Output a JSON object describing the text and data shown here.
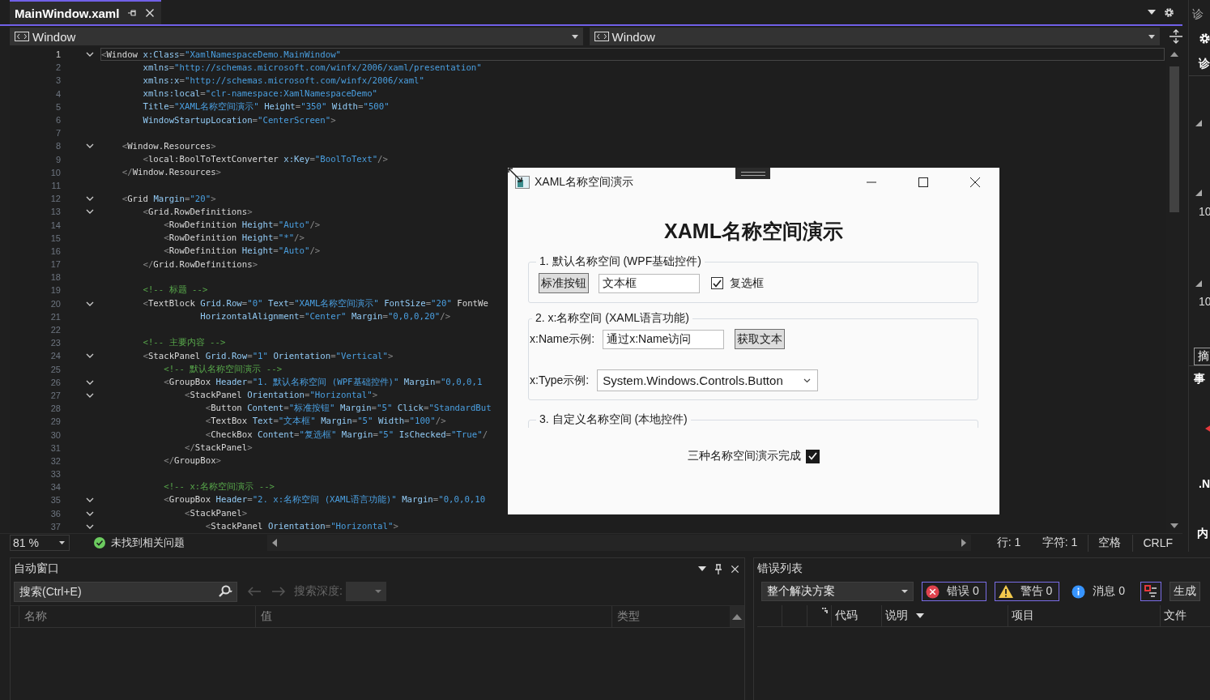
{
  "editor_tab": {
    "title": "MainWindow.xaml",
    "selected": true
  },
  "nav_bar": {
    "left_scope": "Window",
    "right_scope": "Window"
  },
  "code_lines": [
    {
      "number": "1",
      "fold": true,
      "current": true,
      "text": "<Window x:Class=\"XamlNamespaceDemo.MainWindow\""
    },
    {
      "number": "2",
      "fold": false,
      "current": false,
      "text": "        xmlns=\"http://schemas.microsoft.com/winfx/2006/xaml/presentation\""
    },
    {
      "number": "3",
      "fold": false,
      "current": false,
      "text": "        xmlns:x=\"http://schemas.microsoft.com/winfx/2006/xaml\""
    },
    {
      "number": "4",
      "fold": false,
      "current": false,
      "text": "        xmlns:local=\"clr-namespace:XamlNamespaceDemo\""
    },
    {
      "number": "5",
      "fold": false,
      "current": false,
      "text": "        Title=\"XAML名称空间演示\" Height=\"350\" Width=\"500\""
    },
    {
      "number": "6",
      "fold": false,
      "current": false,
      "text": "        WindowStartupLocation=\"CenterScreen\">"
    },
    {
      "number": "7",
      "fold": false,
      "current": false
    },
    {
      "number": "8",
      "fold": true,
      "current": false,
      "text": "    <Window.Resources>"
    },
    {
      "number": "9",
      "fold": false,
      "current": false,
      "text": "        <local:BoolToTextConverter x:Key=\"BoolToText\"/>"
    },
    {
      "number": "10",
      "fold": false,
      "current": false,
      "text": "    </Window.Resources>"
    },
    {
      "number": "11",
      "fold": false,
      "current": false
    },
    {
      "number": "12",
      "fold": true,
      "current": false,
      "text": "    <Grid Margin=\"20\">"
    },
    {
      "number": "13",
      "fold": true,
      "current": false,
      "text": "        <Grid.RowDefinitions>"
    },
    {
      "number": "14",
      "fold": false,
      "current": false,
      "text": "            <RowDefinition Height=\"Auto\"/>"
    },
    {
      "number": "15",
      "fold": false,
      "current": false,
      "text": "            <RowDefinition Height=\"*\"/>"
    },
    {
      "number": "16",
      "fold": false,
      "current": false,
      "text": "            <RowDefinition Height=\"Auto\"/>"
    },
    {
      "number": "17",
      "fold": false,
      "current": false,
      "text": "        </Grid.RowDefinitions>"
    },
    {
      "number": "18",
      "fold": false,
      "current": false
    },
    {
      "number": "19",
      "fold": false,
      "current": false,
      "text": "        <!-- 标题 -->"
    },
    {
      "number": "20",
      "fold": true,
      "current": false,
      "text": "        <TextBlock Grid.Row=\"0\" Text=\"XAML名称空间演示\" FontSize=\"20\" FontWe"
    },
    {
      "number": "21",
      "fold": false,
      "current": false,
      "text": "                   HorizontalAlignment=\"Center\" Margin=\"0,0,0,20\"/>"
    },
    {
      "number": "22",
      "fold": false,
      "current": false
    },
    {
      "number": "23",
      "fold": false,
      "current": false,
      "text": "        <!-- 主要内容 -->"
    },
    {
      "number": "24",
      "fold": true,
      "current": false,
      "text": "        <StackPanel Grid.Row=\"1\" Orientation=\"Vertical\">"
    },
    {
      "number": "25",
      "fold": false,
      "current": false,
      "text": "            <!-- 默认名称空间演示 -->"
    },
    {
      "number": "26",
      "fold": true,
      "current": false,
      "text": "            <GroupBox Header=\"1. 默认名称空间 (WPF基础控件)\" Margin=\"0,0,0,1"
    },
    {
      "number": "27",
      "fold": true,
      "current": false,
      "text": "                <StackPanel Orientation=\"Horizontal\">"
    },
    {
      "number": "28",
      "fold": false,
      "current": false,
      "text": "                    <Button Content=\"标准按钮\" Margin=\"5\" Click=\"StandardBut"
    },
    {
      "number": "29",
      "fold": false,
      "current": false,
      "text": "                    <TextBox Text=\"文本框\" Margin=\"5\" Width=\"100\"/>"
    },
    {
      "number": "30",
      "fold": false,
      "current": false,
      "text": "                    <CheckBox Content=\"复选框\" Margin=\"5\" IsChecked=\"True\"/"
    },
    {
      "number": "31",
      "fold": false,
      "current": false,
      "text": "                </StackPanel>"
    },
    {
      "number": "32",
      "fold": false,
      "current": false,
      "text": "            </GroupBox>"
    },
    {
      "number": "33",
      "fold": false,
      "current": false
    },
    {
      "number": "34",
      "fold": false,
      "current": false,
      "text": "            <!-- x:名称空间演示 -->"
    },
    {
      "number": "35",
      "fold": true,
      "current": false,
      "text": "            <GroupBox Header=\"2. x:名称空间 (XAML语言功能)\" Margin=\"0,0,0,10"
    },
    {
      "number": "36",
      "fold": true,
      "current": false,
      "text": "                <StackPanel>"
    },
    {
      "number": "37",
      "fold": true,
      "current": false,
      "text": "                    <StackPanel Orientation=\"Horizontal\">"
    }
  ],
  "editor_status": {
    "zoom": "81 %",
    "issues": "未找到相关问题",
    "line": "行: 1",
    "char": "字符: 1",
    "indent": "空格",
    "eol": "CRLF"
  },
  "dialog": {
    "title": "XAML名称空间演示",
    "heading": "XAML名称空间演示",
    "group1": {
      "header": "1. 默认名称空间 (WPF基础控件)",
      "button": "标准按钮",
      "textbox_value": "文本框",
      "checkbox": {
        "label": "复选框",
        "checked": true
      }
    },
    "group2": {
      "header": "2. x:名称空间 (XAML语言功能)",
      "name_label": "x:Name示例:",
      "name_value": "通过x:Name访问",
      "get_button": "获取文本",
      "type_label": "x:Type示例:",
      "type_value": "System.Windows.Controls.Button"
    },
    "group3": {
      "header": "3. 自定义名称空间 (本地控件)"
    },
    "status": {
      "label": "三种名称空间演示完成",
      "checked": true
    }
  },
  "side_panel": {
    "title": "诊",
    "heading": "诊",
    "values": [
      "10",
      "10"
    ],
    "summary_tab": "摘",
    "events": "事",
    "dotnet": ".N",
    "memory": "内"
  },
  "autos_panel": {
    "title": "自动窗口",
    "search": {
      "placeholder": "搜索(Ctrl+E)"
    },
    "depth_label": "搜索深度:",
    "columns": [
      "名称",
      "值",
      "类型"
    ]
  },
  "error_list": {
    "title": "错误列表",
    "scope": "整个解决方案",
    "toggles": [
      {
        "kind": "error",
        "label": "错误 0",
        "selected": true
      },
      {
        "kind": "warning",
        "label": "警告 0",
        "selected": true
      },
      {
        "kind": "info",
        "label": "消息 0",
        "selected": false
      }
    ],
    "filter_button": {
      "selected": true
    },
    "build_button": "生成",
    "columns": [
      "代码",
      "说明",
      "项目",
      "文件"
    ]
  }
}
